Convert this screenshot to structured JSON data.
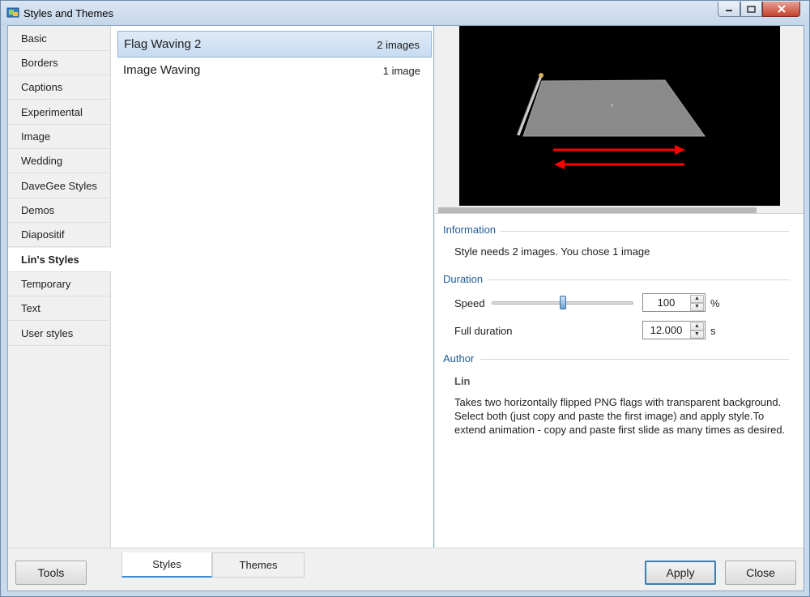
{
  "window": {
    "title": "Styles and Themes",
    "minimize_icon": "minimize-icon",
    "maximize_icon": "maximize-icon",
    "close_icon": "close-icon"
  },
  "categories": [
    {
      "label": "Basic",
      "selected": false
    },
    {
      "label": "Borders",
      "selected": false
    },
    {
      "label": "Captions",
      "selected": false
    },
    {
      "label": "Experimental",
      "selected": false
    },
    {
      "label": "Image",
      "selected": false
    },
    {
      "label": "Wedding",
      "selected": false
    },
    {
      "label": "DaveGee Styles",
      "selected": false
    },
    {
      "label": "Demos",
      "selected": false
    },
    {
      "label": "Diapositif",
      "selected": false
    },
    {
      "label": "Lin's Styles",
      "selected": true
    },
    {
      "label": "Temporary",
      "selected": false
    },
    {
      "label": "Text",
      "selected": false
    },
    {
      "label": "User styles",
      "selected": false
    }
  ],
  "styles": [
    {
      "name": "Flag Waving 2",
      "count": "2 images",
      "selected": true
    },
    {
      "name": "Image Waving",
      "count": "1 image",
      "selected": false
    }
  ],
  "preview": {
    "description_icon": "flag-preview",
    "arrow_color": "#ff0000",
    "flag_color": "#8a8a8a",
    "background_color": "#000000"
  },
  "information": {
    "title": "Information",
    "text": "Style needs 2 images. You chose 1 image"
  },
  "duration": {
    "title": "Duration",
    "speed_label": "Speed",
    "speed_value": "100",
    "speed_unit": "%",
    "speed_slider_fraction": 0.5,
    "full_duration_label": "Full duration",
    "full_duration_value": "12.000",
    "full_duration_unit": "s"
  },
  "author": {
    "title": "Author",
    "name": "Lin",
    "description": "Takes two horizontally flipped PNG flags with transparent background. Select both (just  copy and paste the first image) and apply style.To extend animation - copy and paste first slide as many times as desired."
  },
  "bottom": {
    "tools_label": "Tools",
    "tabs": [
      {
        "label": "Styles",
        "active": true
      },
      {
        "label": "Themes",
        "active": false
      }
    ],
    "apply_label": "Apply",
    "close_label": "Close"
  }
}
